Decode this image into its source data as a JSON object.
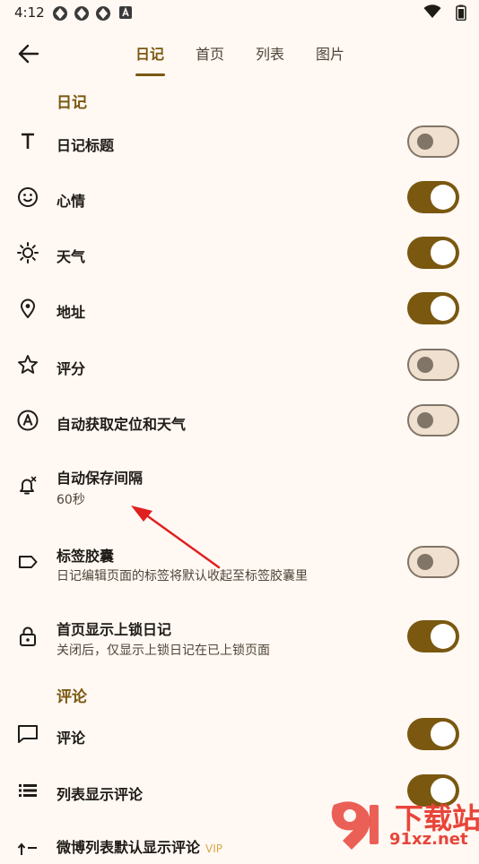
{
  "status_bar": {
    "time": "4:12"
  },
  "tabs": [
    {
      "label": "日记",
      "active": true
    },
    {
      "label": "首页",
      "active": false
    },
    {
      "label": "列表",
      "active": false
    },
    {
      "label": "图片",
      "active": false
    }
  ],
  "sections": {
    "diary": "日记",
    "comments": "评论"
  },
  "rows": [
    {
      "title": "日记标题",
      "toggle": false,
      "icon": "text-title-icon"
    },
    {
      "title": "心情",
      "toggle": true,
      "icon": "smiley-face-icon"
    },
    {
      "title": "天气",
      "toggle": true,
      "icon": "sun-icon"
    },
    {
      "title": "地址",
      "toggle": true,
      "icon": "location-pin-icon"
    },
    {
      "title": "评分",
      "toggle": false,
      "icon": "star-icon"
    },
    {
      "title": "自动获取定位和天气",
      "toggle": false,
      "icon": "auto-a-icon"
    },
    {
      "title": "自动保存间隔",
      "subtitle": "60秒",
      "icon": "alarm-bell-icon"
    },
    {
      "title": "标签胶囊",
      "subtitle": "日记编辑页面的标签将默认收起至标签胶囊里",
      "toggle": false,
      "icon": "tag-icon"
    },
    {
      "title": "首页显示上锁日记",
      "subtitle": "关闭后，仅显示上锁日记在已上锁页面",
      "toggle": true,
      "icon": "lock-icon"
    },
    {
      "title": "评论",
      "toggle": true,
      "icon": "comment-icon"
    },
    {
      "title": "列表显示评论",
      "toggle": true,
      "icon": "list-icon"
    },
    {
      "title": "微博列表默认显示评论",
      "badge": "VIP",
      "icon": "sort-list-icon"
    }
  ],
  "watermark": {
    "text_top": "下载站",
    "text_bottom": "91xz.net"
  },
  "colors": {
    "accent": "#7a5810",
    "background": "#fff8f3",
    "toggle_off_track": "#efe0cf",
    "toggle_off_outline": "#817567",
    "annotation_arrow": "#e02020"
  }
}
